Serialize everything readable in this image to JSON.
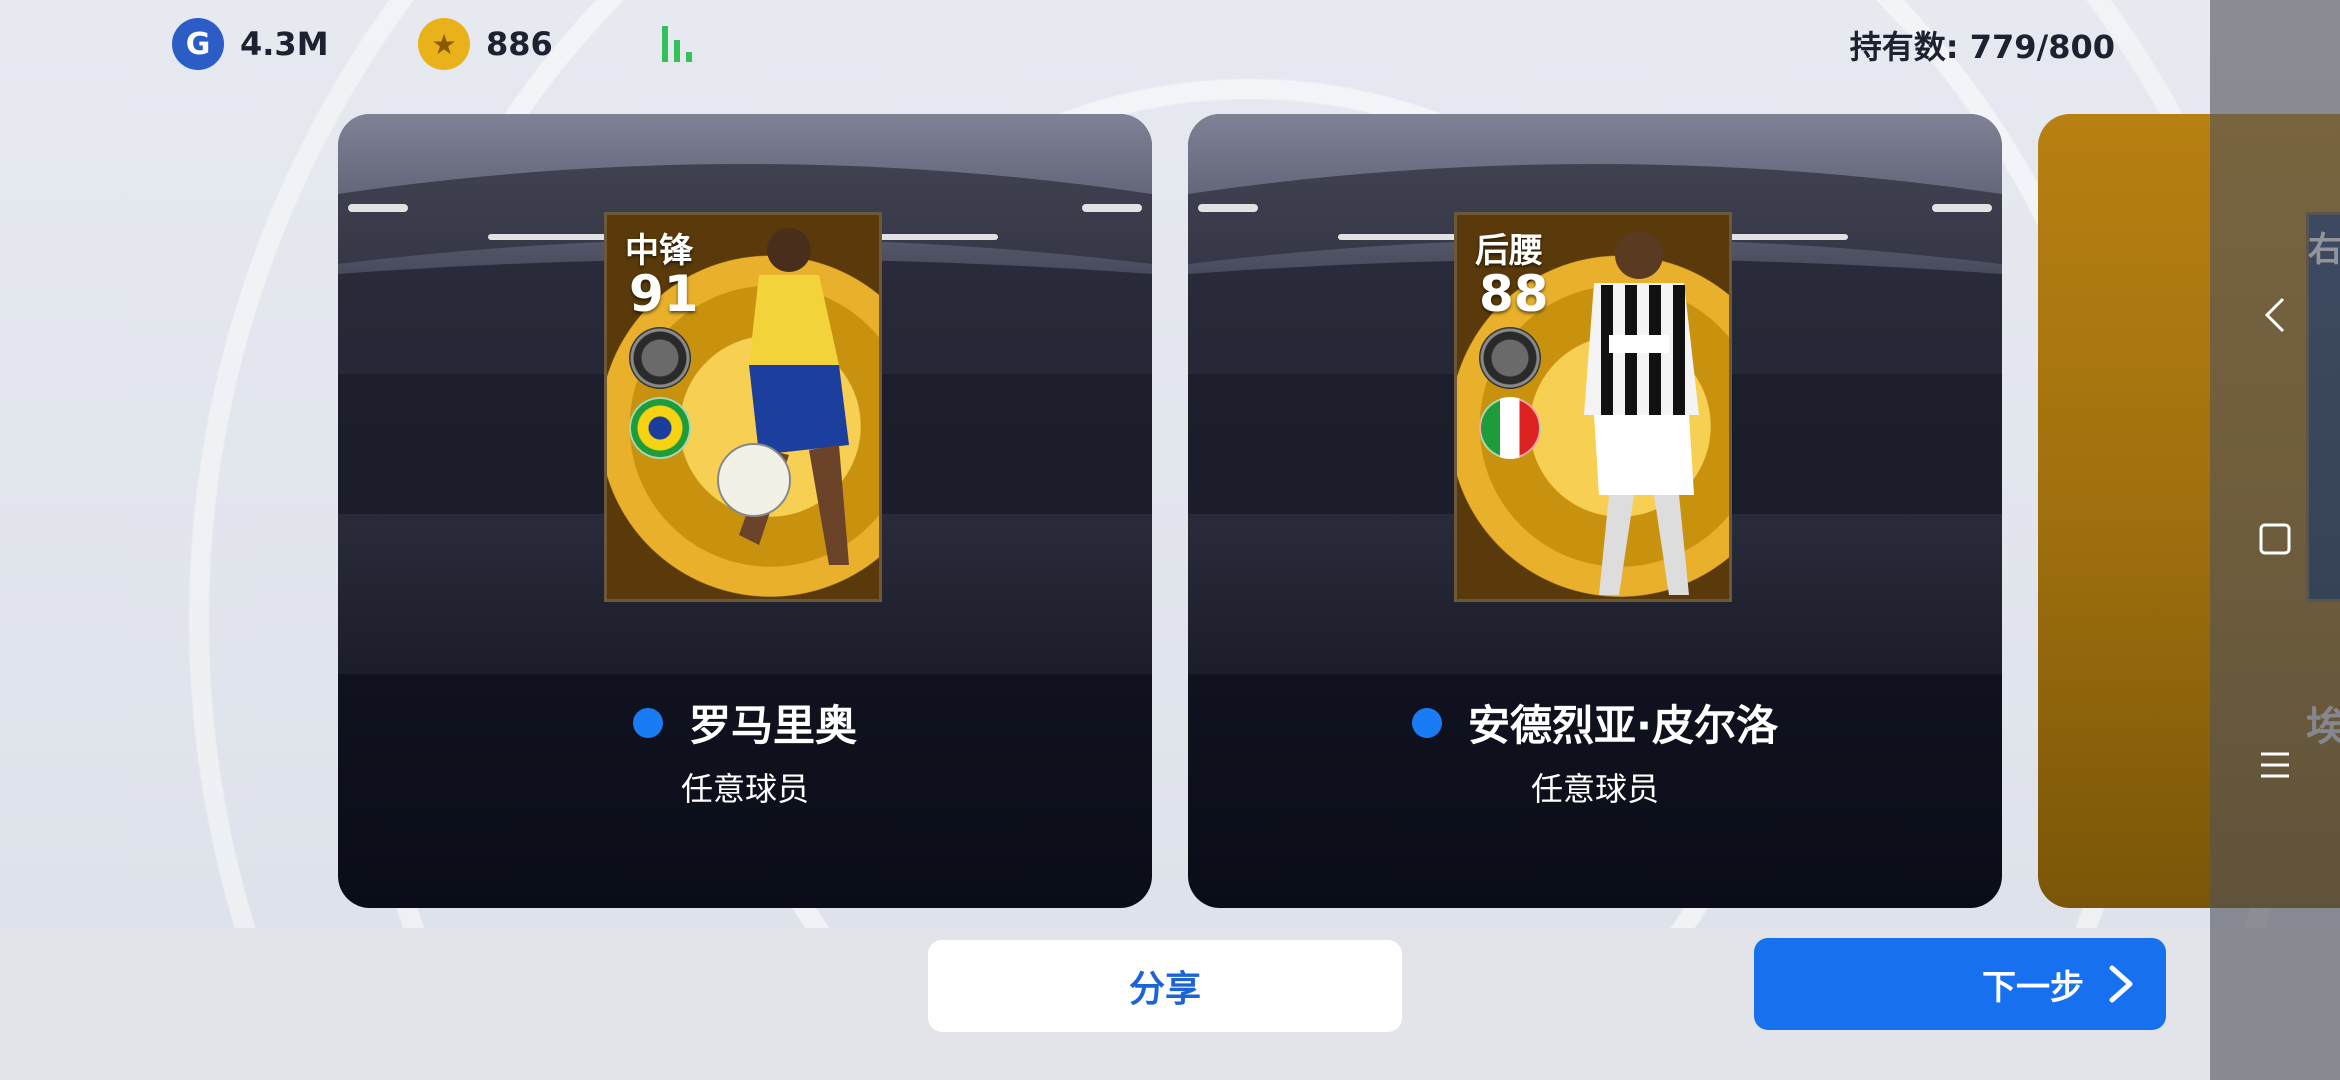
{
  "topbar": {
    "gp_icon": "G",
    "gp_value": "4.3M",
    "coin_icon": "★",
    "coin_value": "886",
    "owned_label": "持有数: 779/800"
  },
  "cards": [
    {
      "position": "中锋",
      "rating": "91",
      "flag": "brazil",
      "name": "罗马里奥",
      "type": "任意球员"
    },
    {
      "position": "后腰",
      "rating": "88",
      "flag": "italy",
      "name": "安德烈亚·皮尔洛",
      "type": "任意球员"
    },
    {
      "position_partial": "右",
      "name_partial": "埃"
    }
  ],
  "buttons": {
    "share_label": "分享",
    "next_label": "下一步"
  },
  "colors": {
    "accent": "#1670ef",
    "share_text": "#1a63d8",
    "dot": "#1a7cf5",
    "signal": "#33c25a"
  }
}
